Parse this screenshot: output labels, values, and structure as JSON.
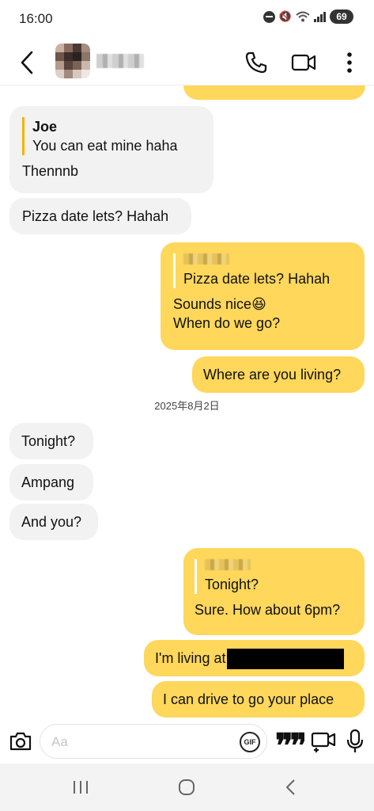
{
  "status": {
    "time": "16:00",
    "battery": "69"
  },
  "header": {
    "back": "back",
    "call": "voice call",
    "video": "video call",
    "more": "more options"
  },
  "messages": {
    "m1": {
      "quote_name": "Joe",
      "quote_text": "You can eat mine haha",
      "text": "Thennnb"
    },
    "m2": {
      "text": "Pizza date lets? Hahah"
    },
    "m3": {
      "quote_text": "Pizza date lets? Hahah",
      "line1": "Sounds nice😆",
      "line2": "When do we go?"
    },
    "m4": {
      "text": "Where are you living?"
    },
    "date": "2025年8月2日",
    "m5": {
      "text": "Tonight?"
    },
    "m6": {
      "text": "Ampang"
    },
    "m7": {
      "text": "And you?"
    },
    "m8": {
      "quote_text": "Tonight?",
      "text": "Sure. How about 6pm?"
    },
    "m9": {
      "text": "I'm living at"
    },
    "m10": {
      "text": "I can drive to go your place"
    }
  },
  "composer": {
    "placeholder": "Aa",
    "gif": "GIF"
  },
  "colors": {
    "outgoing": "#fed75b",
    "incoming": "#f2f2f2",
    "quote_bar": "#f4b400"
  },
  "icons": [
    "back-icon",
    "phone-icon",
    "video-camera-icon",
    "more-vertical-icon",
    "camera-icon",
    "gif-icon",
    "quote-icon",
    "video-message-icon",
    "microphone-icon",
    "recents-icon",
    "home-icon",
    "nav-back-icon"
  ]
}
